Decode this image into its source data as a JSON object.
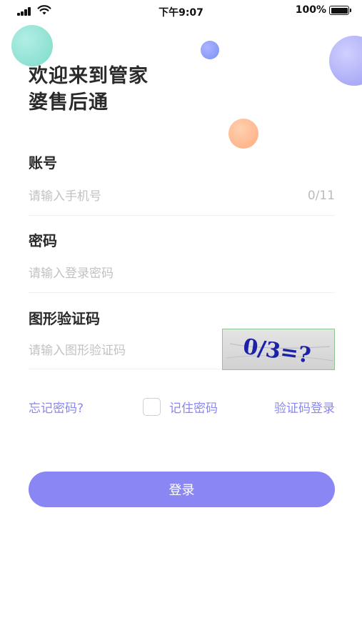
{
  "status_bar": {
    "time": "下午9:07",
    "battery_percent": "100%",
    "battery_level": 1.0,
    "icons": [
      "signal-icon",
      "wifi-icon",
      "battery-icon"
    ]
  },
  "header": {
    "title_line1": "欢迎来到管家",
    "title_line2": "婆售后通"
  },
  "account": {
    "label": "账号",
    "placeholder": "请输入手机号",
    "value": "",
    "counter": "0/11"
  },
  "password": {
    "label": "密码",
    "placeholder": "请输入登录密码",
    "value": ""
  },
  "captcha": {
    "label": "图形验证码",
    "placeholder": "请输入图形验证码",
    "value": "",
    "image_text": "0/3=?"
  },
  "options": {
    "forgot_label": "忘记密码?",
    "remember_label": "记住密码",
    "remember_checked": false,
    "code_login_label": "验证码登录"
  },
  "login_button": {
    "label": "登录"
  },
  "colors": {
    "accent": "#8a86f4",
    "link": "#8a87ee",
    "decor_teal": "#7fdcc9",
    "decor_blue": "#7c8ef5",
    "decor_purple": "#a4a4f5",
    "decor_orange": "#ffad80"
  }
}
